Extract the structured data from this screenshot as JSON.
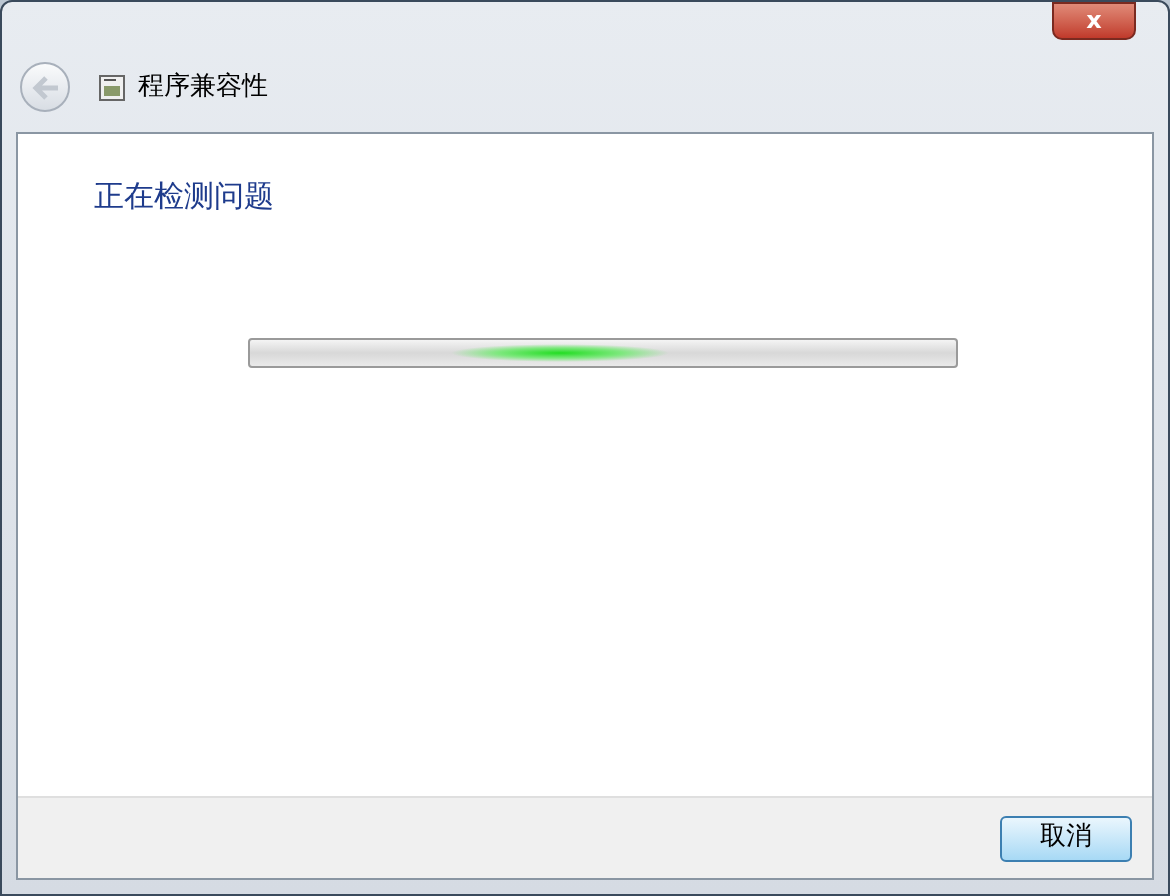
{
  "window": {
    "title": "程序兼容性",
    "close": "x"
  },
  "heading": "正在检测问题",
  "progress": {
    "kind": "marquee"
  },
  "buttons": [
    "取消"
  ]
}
